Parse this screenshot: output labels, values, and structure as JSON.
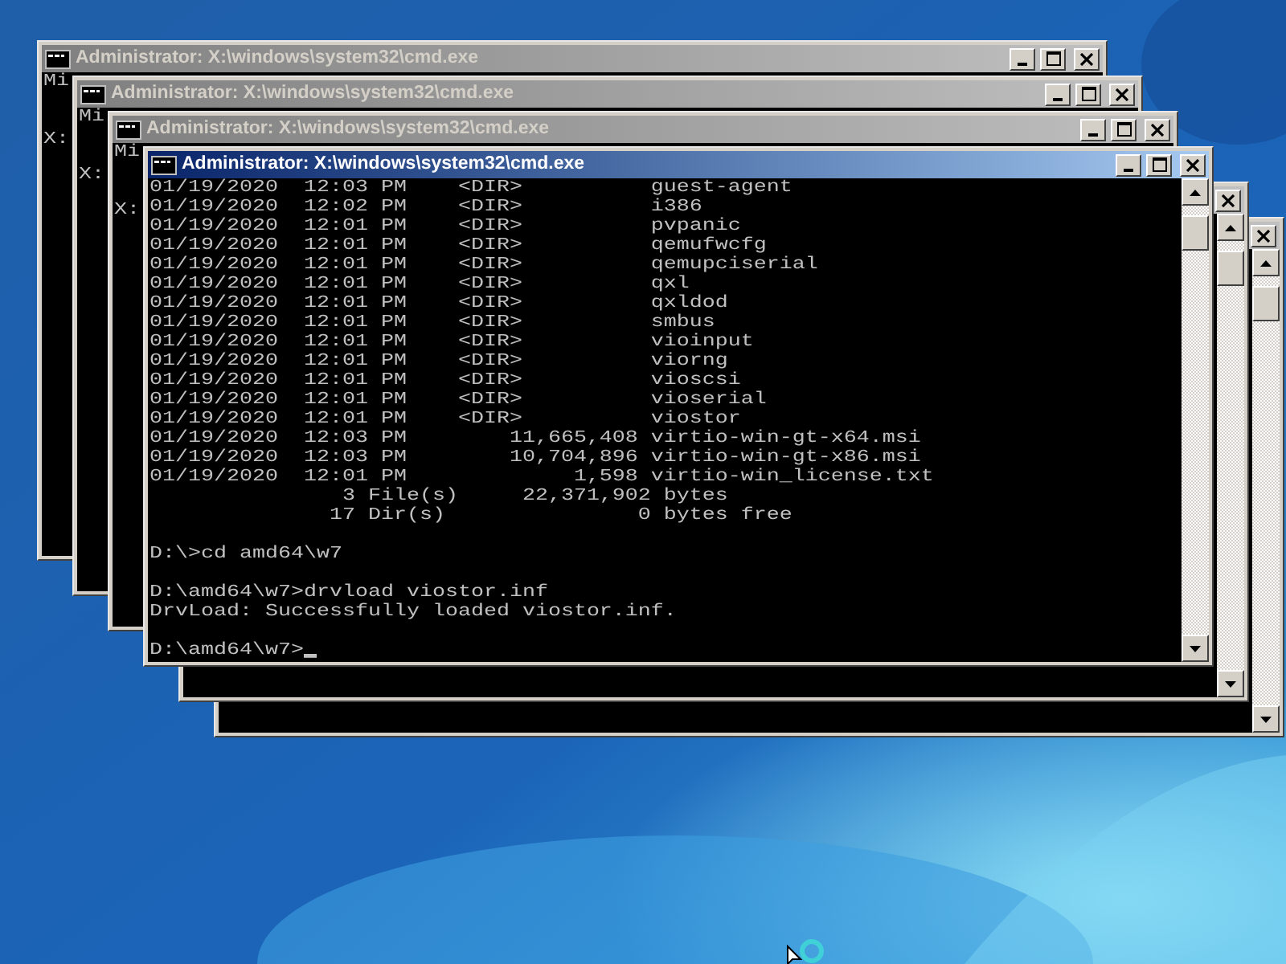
{
  "windows": [
    {
      "title": "Administrator: X:\\windows\\system32\\cmd.exe",
      "active": false,
      "lines": [
        {
          "kind": "text",
          "text": "Mi"
        },
        {
          "kind": "blank"
        },
        {
          "kind": "blank"
        },
        {
          "kind": "text",
          "text": "X:"
        }
      ]
    },
    {
      "title": "Administrator: X:\\windows\\system32\\cmd.exe",
      "active": false,
      "lines": [
        {
          "kind": "text",
          "text": "Mi"
        },
        {
          "kind": "blank"
        },
        {
          "kind": "blank"
        },
        {
          "kind": "text",
          "text": "X:"
        }
      ]
    },
    {
      "title": "Administrator: X:\\windows\\system32\\cmd.exe",
      "active": false,
      "lines": [
        {
          "kind": "text",
          "text": "Mi"
        },
        {
          "kind": "blank"
        },
        {
          "kind": "blank"
        },
        {
          "kind": "text",
          "text": "X:"
        }
      ]
    },
    {
      "title": "Administrator: X:\\windows\\system32\\cmd.exe",
      "active": true,
      "lines": [
        {
          "kind": "text",
          "text": "01/19/2020  12:03 PM    <DIR>          guest-agent"
        },
        {
          "kind": "text",
          "text": "01/19/2020  12:02 PM    <DIR>          i386"
        },
        {
          "kind": "text",
          "text": "01/19/2020  12:01 PM    <DIR>          pvpanic"
        },
        {
          "kind": "text",
          "text": "01/19/2020  12:01 PM    <DIR>          qemufwcfg"
        },
        {
          "kind": "text",
          "text": "01/19/2020  12:01 PM    <DIR>          qemupciserial"
        },
        {
          "kind": "text",
          "text": "01/19/2020  12:01 PM    <DIR>          qxl"
        },
        {
          "kind": "text",
          "text": "01/19/2020  12:01 PM    <DIR>          qxldod"
        },
        {
          "kind": "text",
          "text": "01/19/2020  12:01 PM    <DIR>          smbus"
        },
        {
          "kind": "text",
          "text": "01/19/2020  12:01 PM    <DIR>          vioinput"
        },
        {
          "kind": "text",
          "text": "01/19/2020  12:01 PM    <DIR>          viorng"
        },
        {
          "kind": "text",
          "text": "01/19/2020  12:01 PM    <DIR>          vioscsi"
        },
        {
          "kind": "text",
          "text": "01/19/2020  12:01 PM    <DIR>          vioserial"
        },
        {
          "kind": "text",
          "text": "01/19/2020  12:01 PM    <DIR>          viostor"
        },
        {
          "kind": "text",
          "text": "01/19/2020  12:03 PM        11,665,408 virtio-win-gt-x64.msi"
        },
        {
          "kind": "text",
          "text": "01/19/2020  12:03 PM        10,704,896 virtio-win-gt-x86.msi"
        },
        {
          "kind": "text",
          "text": "01/19/2020  12:01 PM             1,598 virtio-win_license.txt"
        },
        {
          "kind": "text",
          "text": "               3 File(s)     22,371,902 bytes"
        },
        {
          "kind": "text",
          "text": "              17 Dir(s)               0 bytes free"
        },
        {
          "kind": "blank"
        },
        {
          "kind": "text",
          "text": "D:\\>cd amd64\\w7"
        },
        {
          "kind": "blank"
        },
        {
          "kind": "text",
          "text": "D:\\amd64\\w7>drvload viostor.inf"
        },
        {
          "kind": "text",
          "text": "DrvLoad: Successfully loaded viostor.inf."
        },
        {
          "kind": "blank"
        },
        {
          "kind": "text",
          "text": "D:\\amd64\\w7>",
          "cursor": true
        }
      ]
    },
    {
      "active": false
    },
    {
      "active": false
    }
  ]
}
